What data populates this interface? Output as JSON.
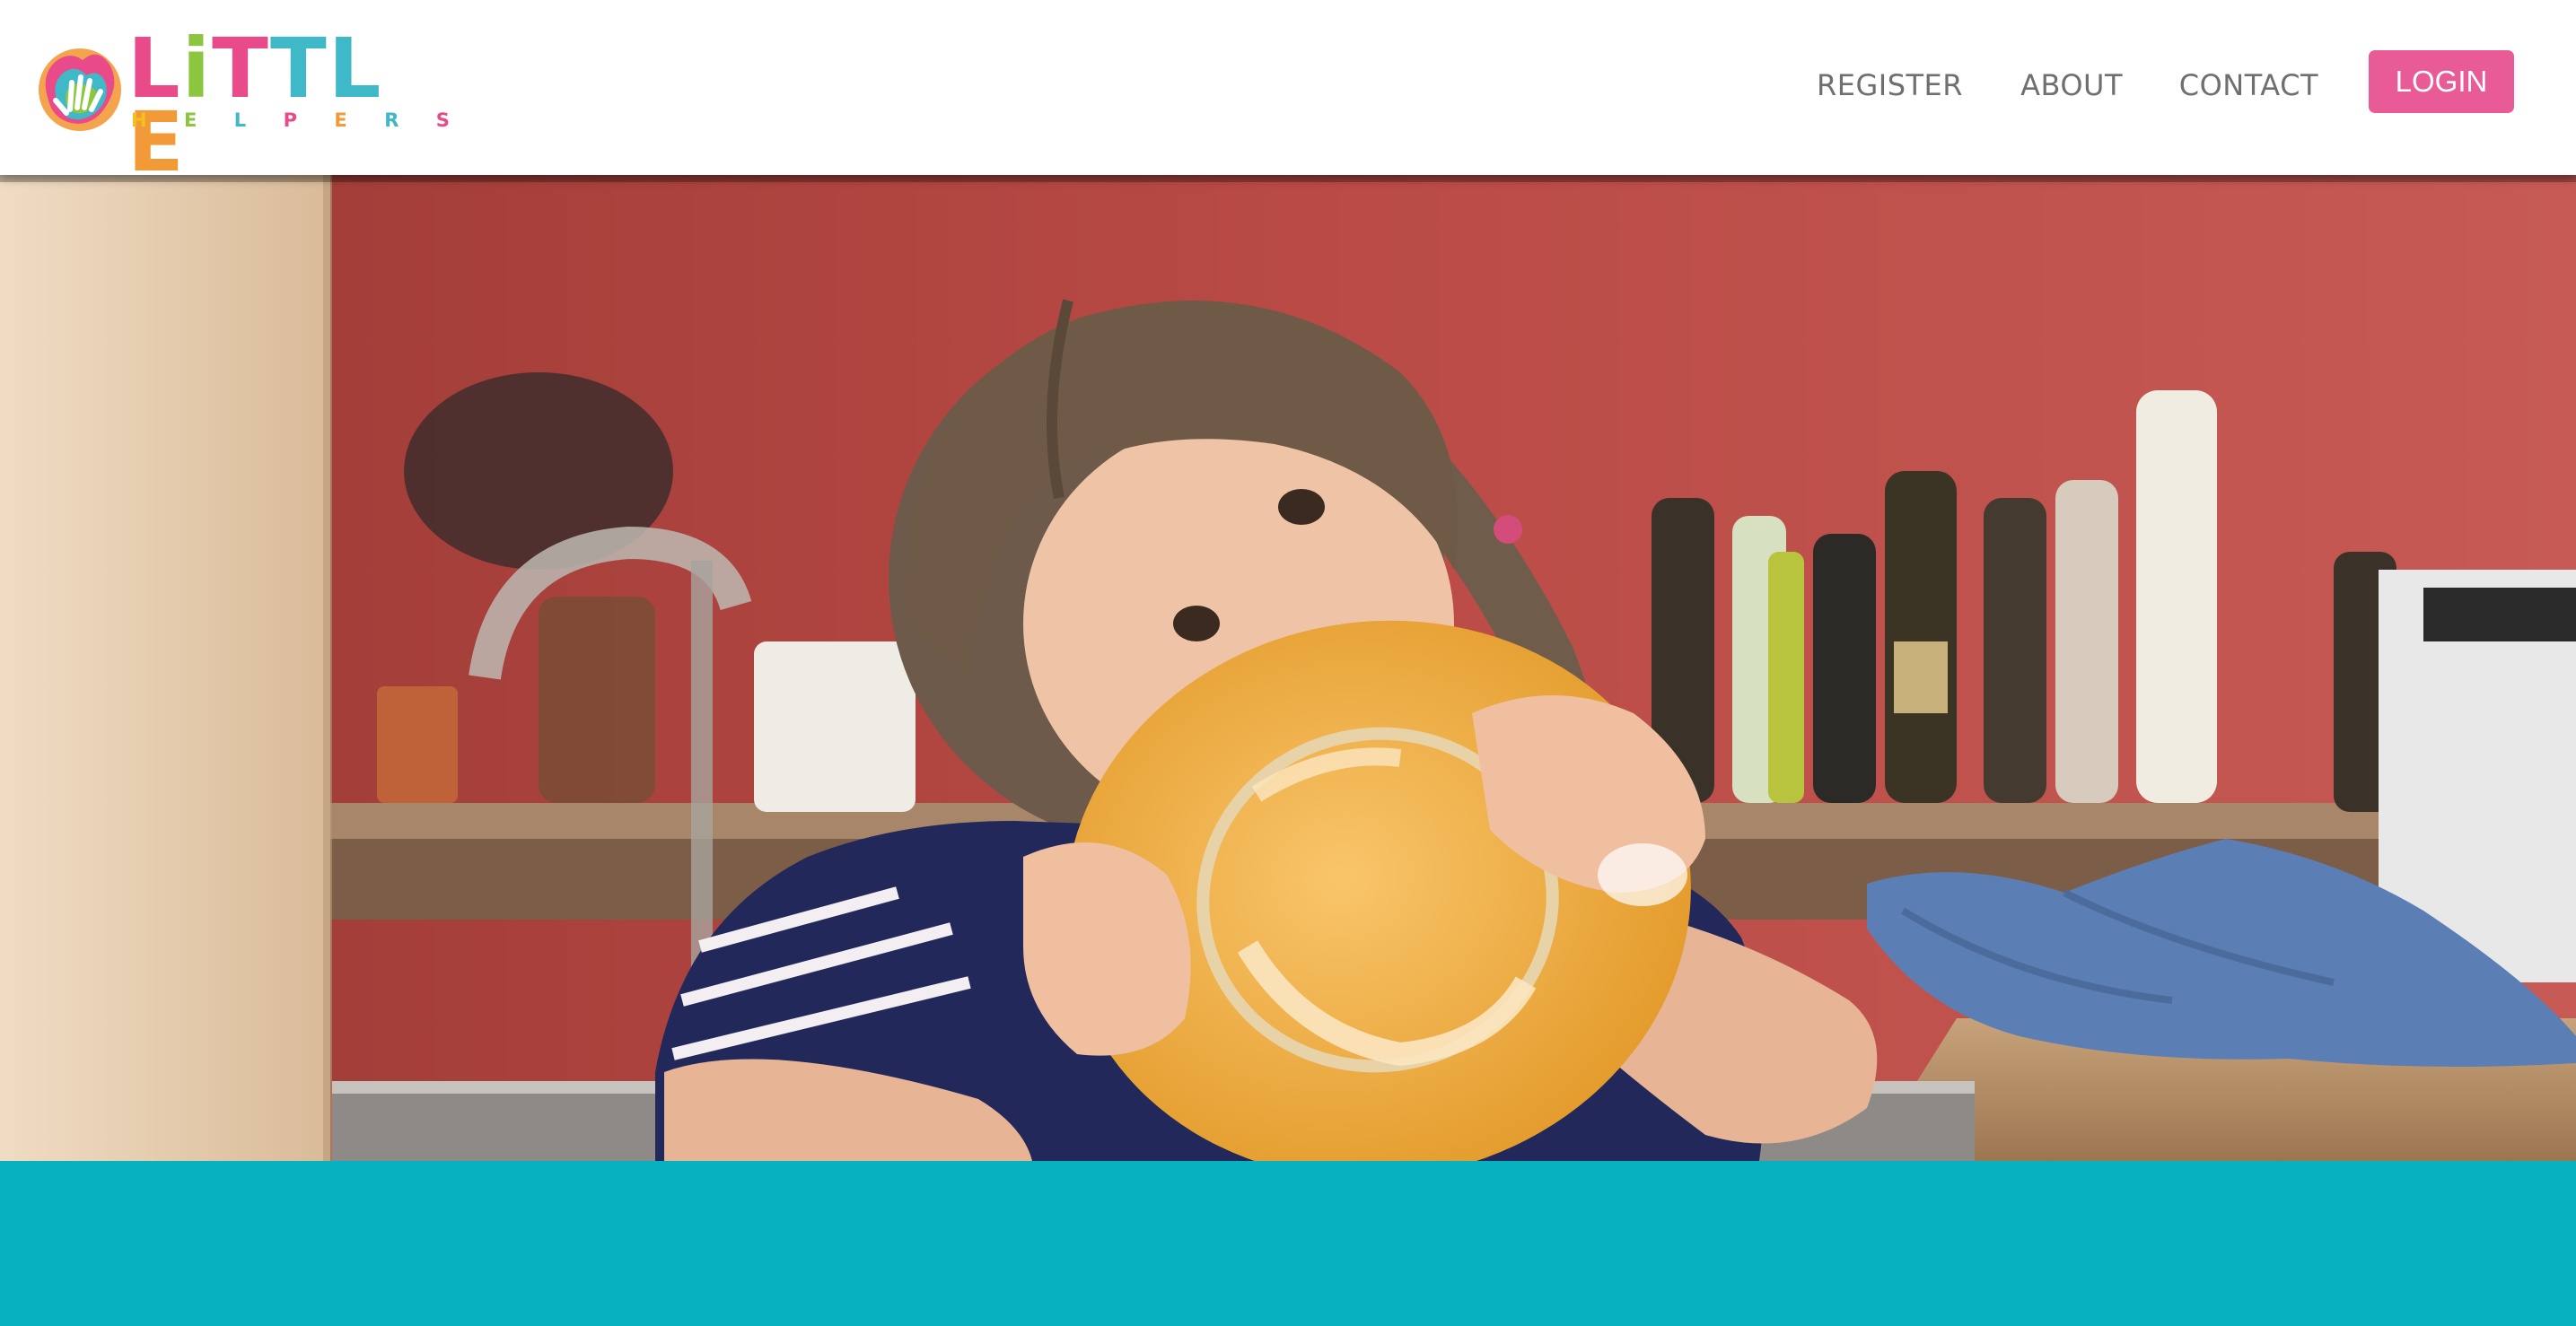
{
  "brand": {
    "wordmark": [
      "L",
      "i",
      "T",
      "T",
      "L",
      "E"
    ],
    "wordmark_colors": [
      "#e94b8a",
      "#8cc63f",
      "#e94b8a",
      "#3fb8c8",
      "#3fb8c8",
      "#f29a38"
    ],
    "tagline": [
      "H",
      "E",
      "L",
      "P",
      "E",
      "R",
      "S"
    ],
    "tagline_colors": [
      "#f2c11d",
      "#8cc63f",
      "#3fb8c8",
      "#e94b8a",
      "#f29a38",
      "#3fb8c8",
      "#e94b8a"
    ],
    "icon": "hand-print-icon"
  },
  "nav": {
    "register": "REGISTER",
    "about": "ABOUT",
    "contact": "CONTACT",
    "login": "LOGIN"
  },
  "colors": {
    "login_bg": "#e95b97",
    "teal": "#07b1c0",
    "nav_text": "#6f6f6f"
  },
  "hero": {
    "image": "girl-washing-yellow-plate-photo"
  }
}
